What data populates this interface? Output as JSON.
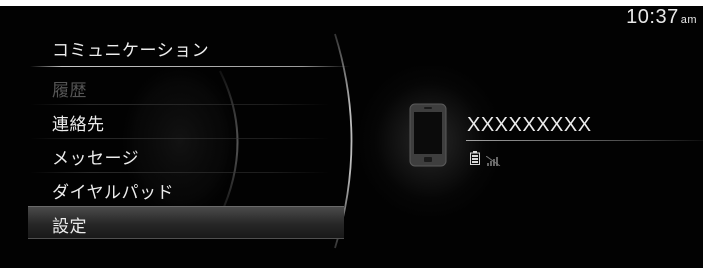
{
  "top_fragment": "",
  "status": {
    "time": "10:37",
    "ampm": "am"
  },
  "menu": {
    "title": "コミュニケーション",
    "items": [
      {
        "label": "履歴",
        "enabled": false
      },
      {
        "label": "連絡先",
        "enabled": true
      },
      {
        "label": "メッセージ",
        "enabled": true
      },
      {
        "label": "ダイヤルパッド",
        "enabled": true
      },
      {
        "label": "設定",
        "enabled": true,
        "selected": true
      }
    ]
  },
  "device": {
    "name": "XXXXXXXXX",
    "icon": "smartphone-icon",
    "battery_icon": "battery-icon",
    "signal_icon": "no-signal-icon"
  },
  "colors": {
    "background": "#020202",
    "text": "#ececec",
    "disabled_text": "#555555",
    "selection_bar": "#3a3a3a"
  }
}
